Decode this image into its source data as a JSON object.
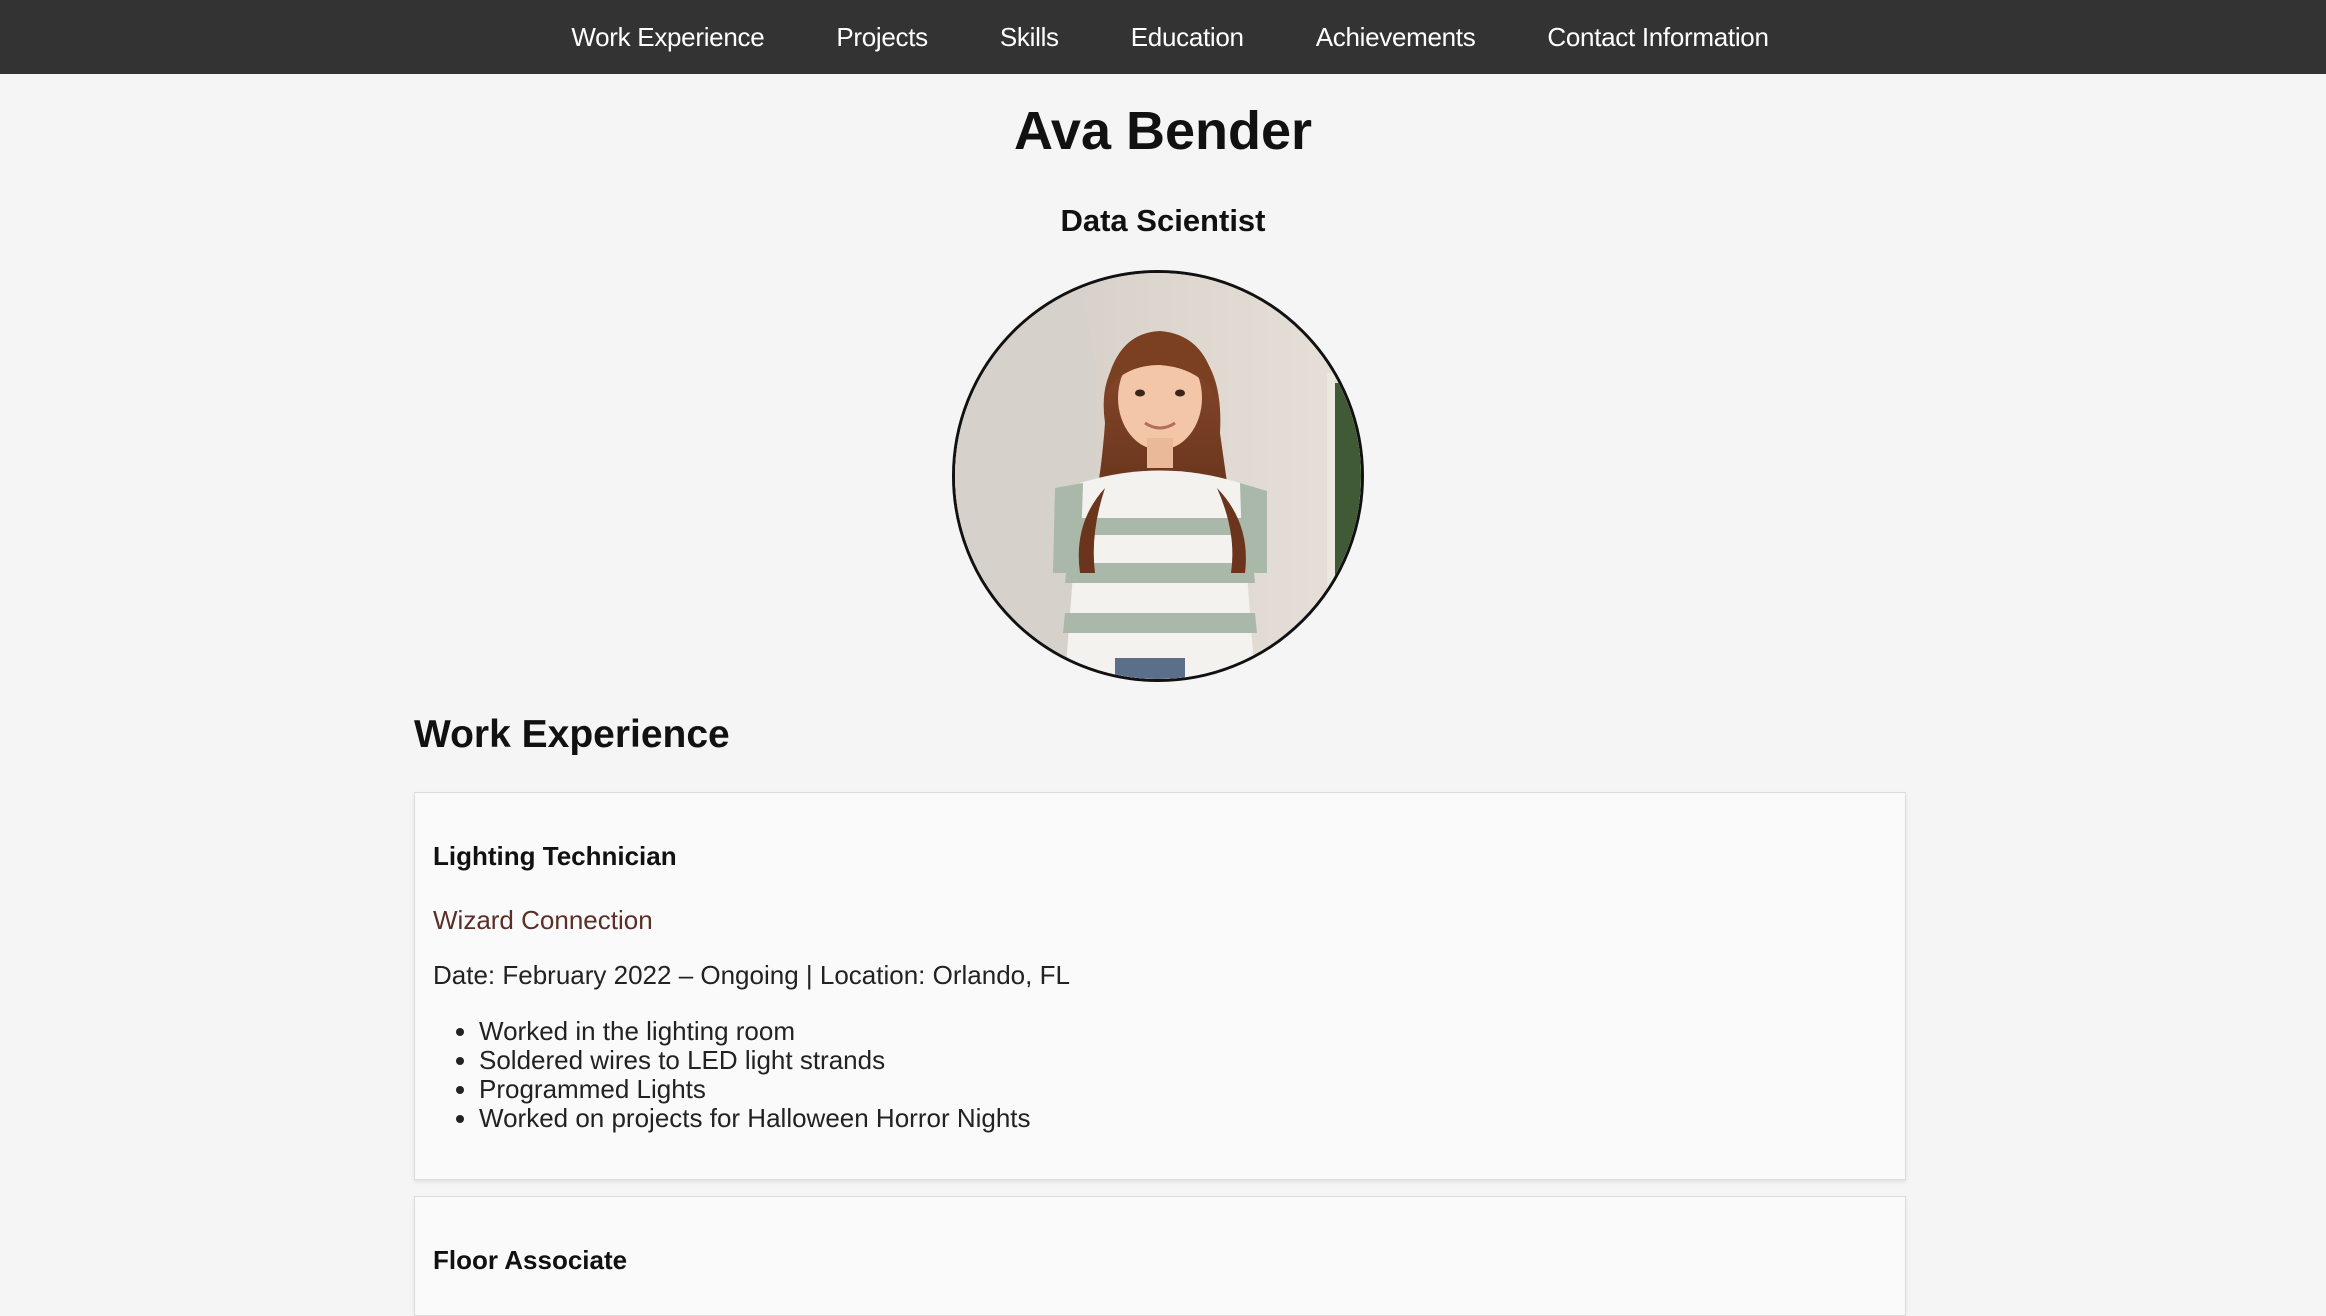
{
  "nav": {
    "items": [
      {
        "label": "Work Experience"
      },
      {
        "label": "Projects"
      },
      {
        "label": "Skills"
      },
      {
        "label": "Education"
      },
      {
        "label": "Achievements"
      },
      {
        "label": "Contact Information"
      }
    ]
  },
  "profile": {
    "name": "Ava Bender",
    "title": "Data Scientist"
  },
  "work": {
    "heading": "Work Experience",
    "jobs": [
      {
        "role": "Lighting Technician",
        "company": "Wizard Connection",
        "meta": "Date: February 2022 – Ongoing | Location: Orlando, FL",
        "bullets": [
          "Worked in the lighting room",
          "Soldered wires to LED light strands",
          "Programmed Lights",
          "Worked on projects for Halloween Horror Nights"
        ]
      },
      {
        "role": "Floor Associate"
      }
    ]
  },
  "colors": {
    "nav_bg": "#333333",
    "page_bg": "#f5f5f5",
    "company_text": "#5a2f27"
  }
}
